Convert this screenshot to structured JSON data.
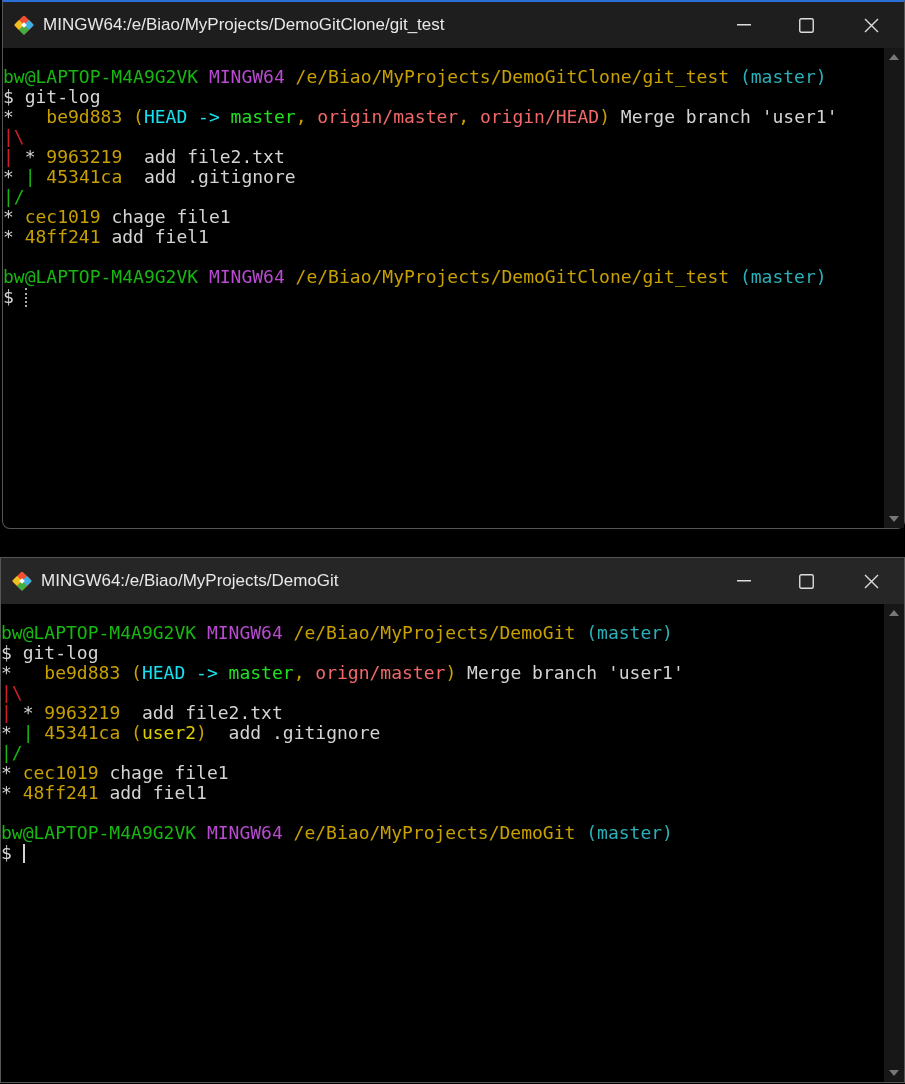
{
  "windows": [
    {
      "title": "MINGW64:/e/Biao/MyProjects/DemoGitClone/git_test",
      "focused": false,
      "blocks": [
        [
          [
            {
              "text": "bw@LAPTOP-M4A9G2VK ",
              "color": "#16b80f"
            },
            {
              "text": "MINGW64 ",
              "color": "#b84bd0"
            },
            {
              "text": "/e/Biao/MyProjects/DemoGitClone/git_test ",
              "color": "#c8a000"
            },
            {
              "text": "(master)",
              "color": "#2ab0b8"
            }
          ],
          [
            {
              "text": "$ git-log",
              "color": "#d4d4d4"
            }
          ],
          [
            {
              "text": "*   ",
              "color": "#d4d4d4"
            },
            {
              "text": "be9d883 (",
              "color": "#c8a000"
            },
            {
              "text": "HEAD -> ",
              "color": "#18e0f0"
            },
            {
              "text": "master",
              "color": "#20e020"
            },
            {
              "text": ", ",
              "color": "#c8a000"
            },
            {
              "text": "origin/master",
              "color": "#f06868"
            },
            {
              "text": ", ",
              "color": "#c8a000"
            },
            {
              "text": "origin/HEAD",
              "color": "#f06868"
            },
            {
              "text": ")",
              "color": "#c8a000"
            },
            {
              "text": " Merge branch 'user1'",
              "color": "#d4d4d4"
            }
          ],
          [
            {
              "text": "|\\",
              "color": "#d0202a"
            }
          ],
          [
            {
              "text": "|",
              "color": "#d0202a"
            },
            {
              "text": " * ",
              "color": "#d4d4d4"
            },
            {
              "text": "9963219",
              "color": "#c8a000"
            },
            {
              "text": "  add file2.txt",
              "color": "#d4d4d4"
            }
          ],
          [
            {
              "text": "* ",
              "color": "#d4d4d4"
            },
            {
              "text": "|",
              "color": "#16b80f"
            },
            {
              "text": " 45341ca",
              "color": "#c8a000"
            },
            {
              "text": "  add .gitignore",
              "color": "#d4d4d4"
            }
          ],
          [
            {
              "text": "|/",
              "color": "#16b80f"
            }
          ],
          [
            {
              "text": "* ",
              "color": "#d4d4d4"
            },
            {
              "text": "cec1019",
              "color": "#c8a000"
            },
            {
              "text": " chage file1",
              "color": "#d4d4d4"
            }
          ],
          [
            {
              "text": "* ",
              "color": "#d4d4d4"
            },
            {
              "text": "48ff241",
              "color": "#c8a000"
            },
            {
              "text": " add fiel1",
              "color": "#d4d4d4"
            }
          ]
        ],
        [
          [
            {
              "text": "bw@LAPTOP-M4A9G2VK ",
              "color": "#16b80f"
            },
            {
              "text": "MINGW64 ",
              "color": "#b84bd0"
            },
            {
              "text": "/e/Biao/MyProjects/DemoGitClone/git_test ",
              "color": "#c8a000"
            },
            {
              "text": "(master)",
              "color": "#2ab0b8"
            }
          ],
          [
            {
              "text": "$ ",
              "color": "#d4d4d4"
            }
          ]
        ]
      ]
    },
    {
      "title": "MINGW64:/e/Biao/MyProjects/DemoGit",
      "focused": true,
      "blocks": [
        [
          [
            {
              "text": "bw@LAPTOP-M4A9G2VK ",
              "color": "#16b80f"
            },
            {
              "text": "MINGW64 ",
              "color": "#b84bd0"
            },
            {
              "text": "/e/Biao/MyProjects/DemoGit ",
              "color": "#c8a000"
            },
            {
              "text": "(master)",
              "color": "#2ab0b8"
            }
          ],
          [
            {
              "text": "$ git-log",
              "color": "#d4d4d4"
            }
          ],
          [
            {
              "text": "*   ",
              "color": "#d4d4d4"
            },
            {
              "text": "be9d883 (",
              "color": "#c8a000"
            },
            {
              "text": "HEAD -> ",
              "color": "#18e0f0"
            },
            {
              "text": "master",
              "color": "#20e020"
            },
            {
              "text": ", ",
              "color": "#c8a000"
            },
            {
              "text": "orign/master",
              "color": "#f06868"
            },
            {
              "text": ")",
              "color": "#c8a000"
            },
            {
              "text": " Merge branch 'user1'",
              "color": "#d4d4d4"
            }
          ],
          [
            {
              "text": "|\\",
              "color": "#d0202a"
            }
          ],
          [
            {
              "text": "|",
              "color": "#d0202a"
            },
            {
              "text": " * ",
              "color": "#d4d4d4"
            },
            {
              "text": "9963219",
              "color": "#c8a000"
            },
            {
              "text": "  add file2.txt",
              "color": "#d4d4d4"
            }
          ],
          [
            {
              "text": "* ",
              "color": "#d4d4d4"
            },
            {
              "text": "|",
              "color": "#16b80f"
            },
            {
              "text": " 45341ca (",
              "color": "#c8a000"
            },
            {
              "text": "user2",
              "color": "#e0d000"
            },
            {
              "text": ")",
              "color": "#c8a000"
            },
            {
              "text": "  add .gitignore",
              "color": "#d4d4d4"
            }
          ],
          [
            {
              "text": "|/",
              "color": "#16b80f"
            }
          ],
          [
            {
              "text": "* ",
              "color": "#d4d4d4"
            },
            {
              "text": "cec1019",
              "color": "#c8a000"
            },
            {
              "text": " chage file1",
              "color": "#d4d4d4"
            }
          ],
          [
            {
              "text": "* ",
              "color": "#d4d4d4"
            },
            {
              "text": "48ff241",
              "color": "#c8a000"
            },
            {
              "text": " add fiel1",
              "color": "#d4d4d4"
            }
          ]
        ],
        [
          [
            {
              "text": "bw@LAPTOP-M4A9G2VK ",
              "color": "#16b80f"
            },
            {
              "text": "MINGW64 ",
              "color": "#b84bd0"
            },
            {
              "text": "/e/Biao/MyProjects/DemoGit ",
              "color": "#c8a000"
            },
            {
              "text": "(master)",
              "color": "#2ab0b8"
            }
          ],
          [
            {
              "text": "$ ",
              "color": "#d4d4d4"
            }
          ]
        ]
      ]
    }
  ]
}
